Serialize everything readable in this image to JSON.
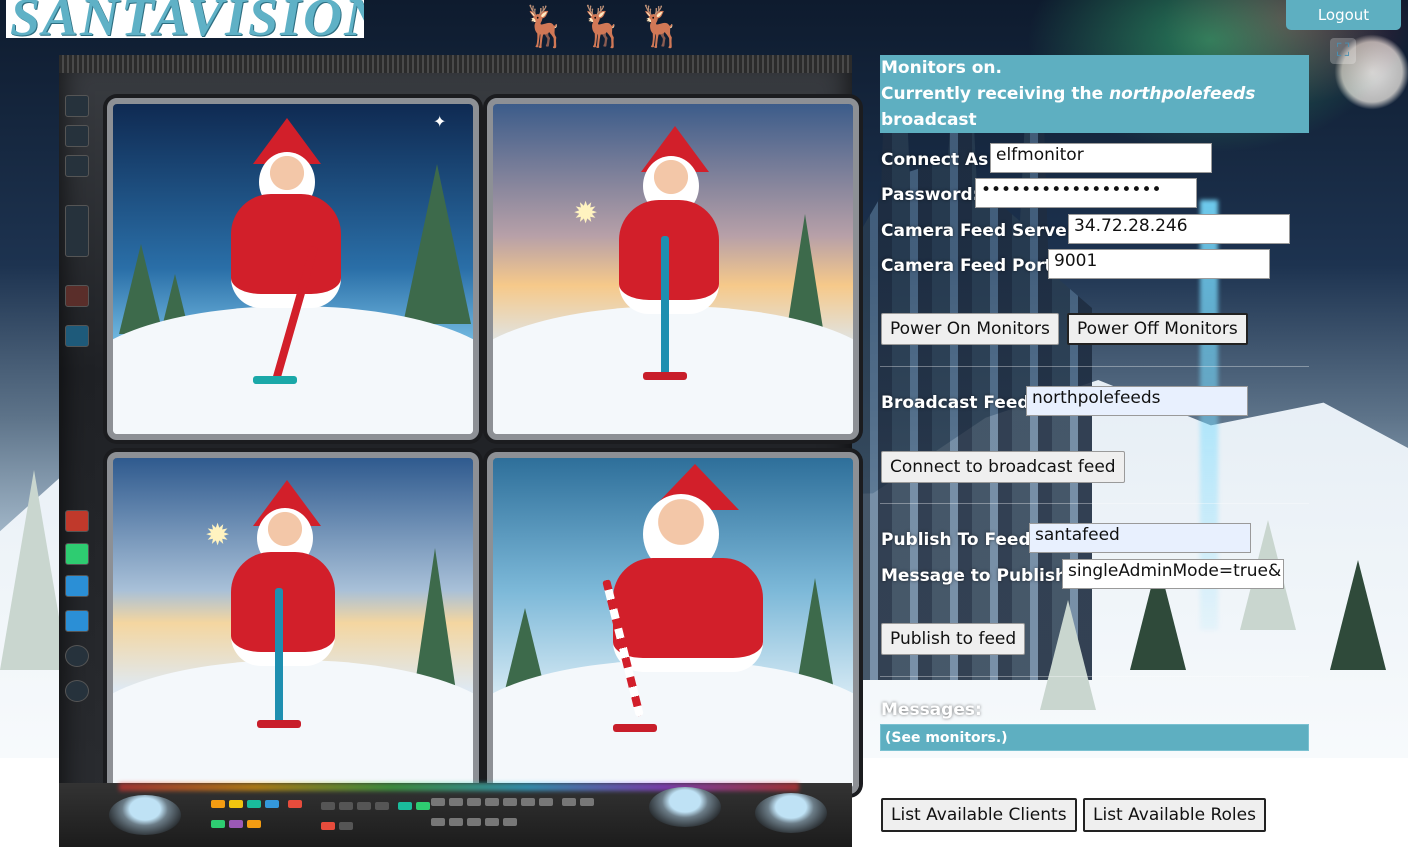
{
  "header": {
    "logo_text": "SANTAVISION",
    "logout_label": "Logout"
  },
  "status": {
    "line1": "Monitors on.",
    "line2_prefix": "Currently receiving the ",
    "line2_feed": "northpolefeeds",
    "line3": "broadcast"
  },
  "connection": {
    "connect_as_label": "Connect As:",
    "connect_as_value": "elfmonitor",
    "password_label": "Password:",
    "password_value": "••••••••••••••••••",
    "server_label": "Camera Feed Server:",
    "server_value": "34.72.28.246",
    "port_label": "Camera Feed Port:",
    "port_value": "9001",
    "power_on_label": "Power On Monitors",
    "power_off_label": "Power Off Monitors"
  },
  "broadcast": {
    "label": "Broadcast Feed:",
    "value": "northpolefeeds",
    "connect_label": "Connect to broadcast feed"
  },
  "publish": {
    "feed_label": "Publish To Feed:",
    "feed_value": "santafeed",
    "message_label": "Message to Publish:",
    "message_value": "singleAdminMode=true&",
    "publish_label": "Publish to feed"
  },
  "messages": {
    "label": "Messages:",
    "content": "(See monitors.)"
  },
  "footer": {
    "list_clients_label": "List Available Clients",
    "list_roles_label": "List Available Roles"
  },
  "icons": {
    "fullscreen": "fullscreen-icon",
    "reindeer": "reindeer-icon"
  },
  "colors": {
    "accent": "#5eafc1",
    "santa_red": "#d21f2a"
  }
}
